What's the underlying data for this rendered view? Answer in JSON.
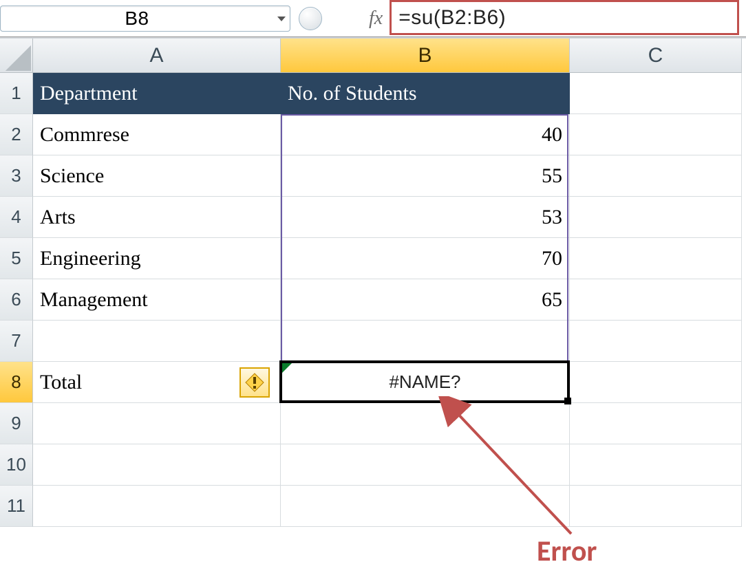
{
  "formula_bar": {
    "cell_ref": "B8",
    "fx_label": "fx",
    "formula": "=su(B2:B6)"
  },
  "columns": {
    "A": "A",
    "B": "B",
    "C": "C"
  },
  "row_labels": [
    "1",
    "2",
    "3",
    "4",
    "5",
    "6",
    "7",
    "8",
    "9",
    "10",
    "11"
  ],
  "headers": {
    "A": "Department",
    "B": "No. of Students"
  },
  "rows": [
    {
      "dept": "Commrese",
      "count": "40"
    },
    {
      "dept": "Science",
      "count": "55"
    },
    {
      "dept": "Arts",
      "count": "53"
    },
    {
      "dept": "Engineering",
      "count": "70"
    },
    {
      "dept": "Management",
      "count": "65"
    }
  ],
  "total": {
    "label": "Total",
    "value": "#NAME?"
  },
  "annotation": {
    "error": "Error"
  },
  "selection": {
    "cell": "B8",
    "highlight_range": "B2:B7"
  }
}
